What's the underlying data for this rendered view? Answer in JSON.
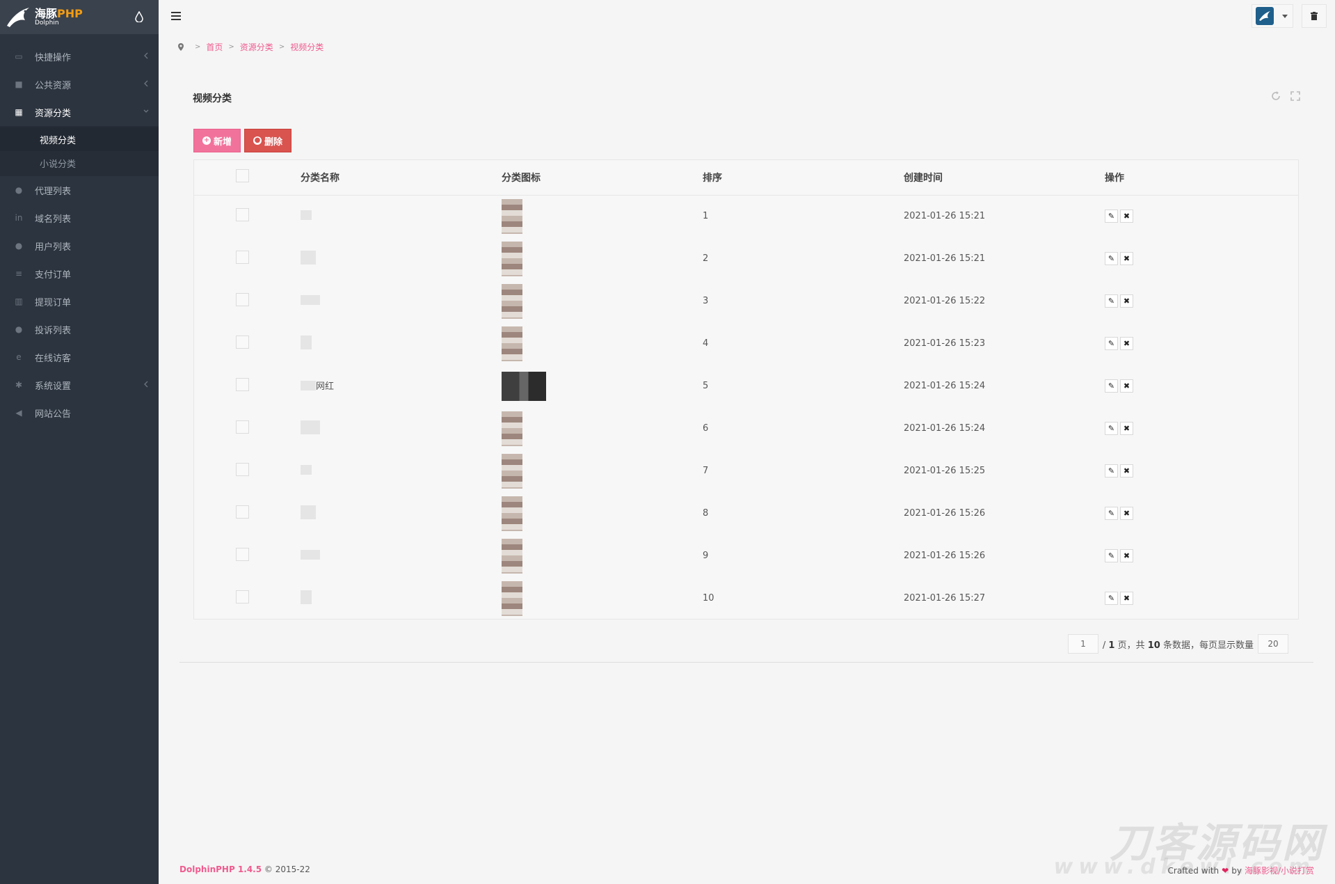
{
  "brand": {
    "name_cn": "海豚",
    "name_php": "PHP",
    "sub": "Dolphin"
  },
  "sidebar": {
    "items": [
      {
        "label": "快捷操作",
        "icon": "folder-icon",
        "has_chevron": true
      },
      {
        "label": "公共资源",
        "icon": "video-camera-icon",
        "has_chevron": true
      },
      {
        "label": "资源分类",
        "icon": "grid-icon",
        "has_chevron": true,
        "open": true,
        "children": [
          {
            "label": "视频分类",
            "active": true
          },
          {
            "label": "小说分类"
          }
        ]
      },
      {
        "label": "代理列表",
        "icon": "users-icon"
      },
      {
        "label": "域名列表",
        "icon": "linkedin-icon"
      },
      {
        "label": "用户列表",
        "icon": "user-icon"
      },
      {
        "label": "支付订单",
        "icon": "list-icon"
      },
      {
        "label": "提现订单",
        "icon": "bank-icon"
      },
      {
        "label": "投诉列表",
        "icon": "alert-icon"
      },
      {
        "label": "在线访客",
        "icon": "edge-icon"
      },
      {
        "label": "系统设置",
        "icon": "gear-icon",
        "has_chevron": true
      },
      {
        "label": "网站公告",
        "icon": "bullhorn-icon"
      }
    ]
  },
  "breadcrumb": [
    "首页",
    "资源分类",
    "视频分类"
  ],
  "panel": {
    "title": "视频分类"
  },
  "toolbar": {
    "add_label": "新增",
    "delete_label": "删除"
  },
  "table": {
    "columns": [
      "分类名称",
      "分类图标",
      "排序",
      "创建时间",
      "操作"
    ],
    "rows": [
      {
        "name": "",
        "sort": "1",
        "created": "2021-01-26 15:21"
      },
      {
        "name": "",
        "sort": "2",
        "created": "2021-01-26 15:21"
      },
      {
        "name": "",
        "sort": "3",
        "created": "2021-01-26 15:22"
      },
      {
        "name": "",
        "sort": "4",
        "created": "2021-01-26 15:23"
      },
      {
        "name": "网红",
        "sort": "5",
        "created": "2021-01-26 15:24"
      },
      {
        "name": "",
        "sort": "6",
        "created": "2021-01-26 15:24"
      },
      {
        "name": "",
        "sort": "7",
        "created": "2021-01-26 15:25"
      },
      {
        "name": "",
        "sort": "8",
        "created": "2021-01-26 15:26"
      },
      {
        "name": "",
        "sort": "9",
        "created": "2021-01-26 15:26"
      },
      {
        "name": "",
        "sort": "10",
        "created": "2021-01-26 15:27"
      }
    ]
  },
  "pager": {
    "current": "1",
    "total_pages": "1",
    "total_items": "10",
    "page_size": "20",
    "text_page": "页，共",
    "text_items": "条数据，每页显示数量"
  },
  "footer": {
    "version": "DolphinPHP 1.4.5",
    "copyright": "© 2015-22",
    "crafted": "Crafted with",
    "by": "by",
    "link": "海豚影视/小说打赏"
  },
  "watermark": {
    "main": "刀客源码网",
    "sub": "www.dkewl.com"
  },
  "colors": {
    "accent": "#ef5b8f",
    "sidebar": "#2c343f",
    "danger": "#d9534f",
    "add": "#f1739c"
  }
}
